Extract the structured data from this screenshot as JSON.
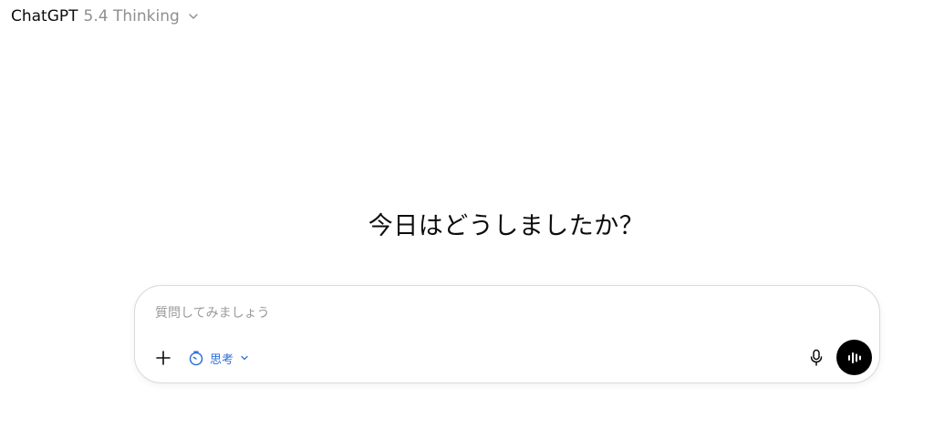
{
  "header": {
    "brand": "ChatGPT",
    "model": "5.4 Thinking",
    "chevron_icon": "chevron-down-icon"
  },
  "main": {
    "greeting": "今日はどうしましたか？"
  },
  "composer": {
    "placeholder": "質問してみましょう",
    "value": "",
    "plus_icon": "plus-icon",
    "think_label": "思考",
    "think_icon": "stopwatch-icon",
    "think_color": "#2f6fdc",
    "mic_icon": "microphone-icon",
    "voice_icon": "voice-waveform-icon",
    "voice_button_color": "#000000"
  }
}
